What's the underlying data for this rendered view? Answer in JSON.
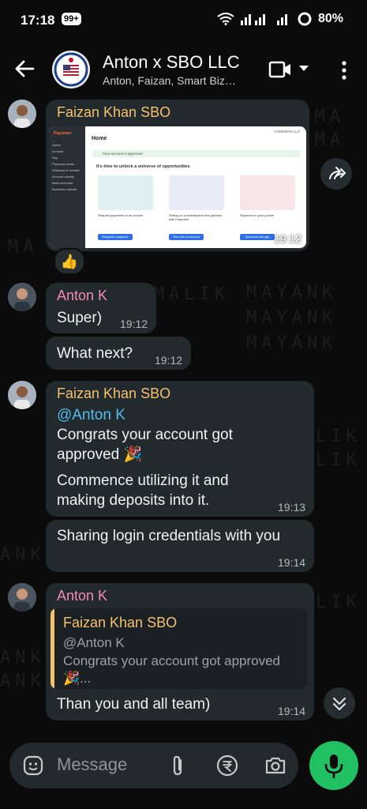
{
  "status_bar": {
    "time": "17:18",
    "badge": "99+",
    "battery": "80%"
  },
  "header": {
    "title": "Anton x SBO LLC",
    "subtitle": "Anton, Faizan, Smart Biz…"
  },
  "watermark": "MAYANK MALIK",
  "messages": [
    {
      "sender": "Faizan Khan SBO",
      "time": "19:12",
      "reaction": "👍",
      "screenshot": {
        "brand": "Payoneer",
        "page": "Home",
        "user": "LONGMAN LLC",
        "banner": "Your account is approved",
        "heading": "It's time to unlock a universe of opportunities",
        "cards": [
          {
            "label": "Request payments to an invoice",
            "button": "Request a payment"
          },
          {
            "label": "Selling on a marketplace that partners with Payoneer",
            "button": "See how to connect"
          },
          {
            "label": "Payoneer in your pocket",
            "button": "Download the app"
          }
        ],
        "nav": [
          "Home",
          "Account",
          "Pay",
          "Payoneer cards",
          "Withdraw & transfer",
          "Account activity",
          "Bank accounts",
          "Business network"
        ]
      }
    },
    {
      "sender": "Anton K",
      "text": "Super)",
      "time": "19:12"
    },
    {
      "text": "What next?",
      "time": "19:12"
    },
    {
      "sender": "Faizan Khan SBO",
      "mention": "@Anton K",
      "line1": "Congrats your account got approved 🎉",
      "line2": "Commence utilizing it and making deposits into it.",
      "time": "19:13"
    },
    {
      "text": "Sharing login credentials with you",
      "time": "19:14"
    },
    {
      "sender": "Anton K",
      "quote": {
        "sender": "Faizan Khan SBO",
        "mention": "@Anton K",
        "text": "Congrats your account got approved 🎉..."
      },
      "text": "Than you and all team)",
      "time": "19:14"
    }
  ],
  "input": {
    "placeholder": "Message"
  },
  "colors": {
    "faizan": "#f5c16c",
    "anton": "#f28cb0",
    "mention": "#53bdeb",
    "quote_bar": "#f5c16c",
    "mic": "#21c063"
  }
}
